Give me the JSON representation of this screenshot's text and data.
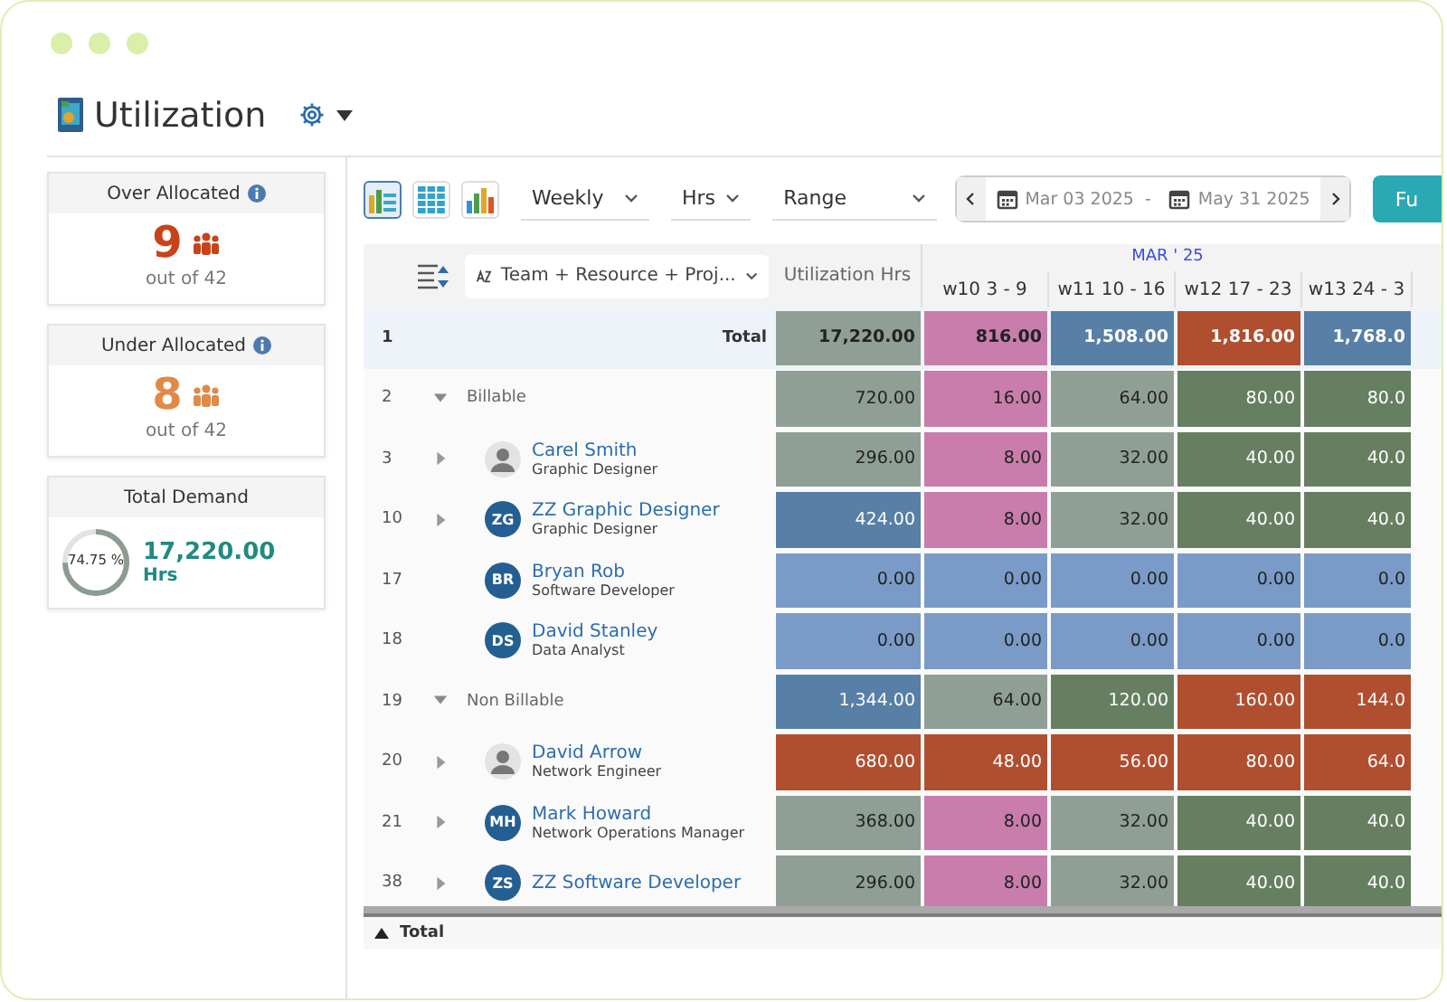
{
  "title": "Utilization",
  "cards": [
    {
      "kind": "count",
      "title": "Over Allocated",
      "value": "9",
      "color": "#c8421a",
      "subtitle": "out of 42"
    },
    {
      "kind": "count",
      "title": "Under Allocated",
      "value": "8",
      "color": "#e08a4a",
      "subtitle": "out of 42"
    },
    {
      "kind": "donut",
      "title": "Total Demand",
      "percent": "74.75 %",
      "level": 0.7475,
      "value": "17,220.00",
      "unit": "Hrs"
    }
  ],
  "toolbar": {
    "views": [
      {
        "selected": true
      },
      {
        "selected": false
      },
      {
        "selected": false
      }
    ],
    "dropdowns": [
      {
        "value": "Weekly"
      },
      {
        "value": "Hrs"
      },
      {
        "value": "Range"
      }
    ],
    "date_start": "Mar 03 2025",
    "date_separator": "-",
    "date_end": "May 31 2025",
    "button": "Fu"
  },
  "grid": {
    "group_by": "Team + Resource + Proj...",
    "util_header": "Utilization Hrs",
    "month": "MAR ' 25",
    "weeks": [
      "w10 3 - 9",
      "w11 10 - 16",
      "w12 17 - 23",
      "w13 24 - 3"
    ],
    "rows": [
      {
        "number": "1",
        "kind": "total",
        "label": "Total",
        "cells": [
          {
            "value": "17,220.00",
            "color": "#909f95"
          },
          {
            "value": "816.00",
            "color": "#c87dac"
          },
          {
            "value": "1,508.00",
            "color": "#587fa5"
          },
          {
            "value": "1,816.00",
            "color": "#b04f30"
          },
          {
            "value": "1,768.0",
            "color": "#587fa5"
          }
        ]
      },
      {
        "number": "2",
        "kind": "group",
        "label": "Billable",
        "expanded": true,
        "cells": [
          {
            "value": "720.00",
            "color": "#909f95"
          },
          {
            "value": "16.00",
            "color": "#c87dac"
          },
          {
            "value": "64.00",
            "color": "#909f95"
          },
          {
            "value": "80.00",
            "color": "#667f61"
          },
          {
            "value": "80.0",
            "color": "#667f61"
          }
        ]
      },
      {
        "number": "3",
        "kind": "person",
        "name": "Carel Smith",
        "role": "Graphic Designer",
        "avatar": {
          "kind": "photo"
        },
        "expanded": false,
        "cells": [
          {
            "value": "296.00",
            "color": "#909f95"
          },
          {
            "value": "8.00",
            "color": "#c87dac"
          },
          {
            "value": "32.00",
            "color": "#909f95"
          },
          {
            "value": "40.00",
            "color": "#667f61"
          },
          {
            "value": "40.0",
            "color": "#667f61"
          }
        ]
      },
      {
        "number": "10",
        "kind": "person",
        "name": "ZZ Graphic Designer",
        "role": "Graphic Designer",
        "avatar": {
          "kind": "initials",
          "text": "ZG"
        },
        "expanded": false,
        "cells": [
          {
            "value": "424.00",
            "color": "#587fa5"
          },
          {
            "value": "8.00",
            "color": "#c87dac"
          },
          {
            "value": "32.00",
            "color": "#909f95"
          },
          {
            "value": "40.00",
            "color": "#667f61"
          },
          {
            "value": "40.0",
            "color": "#667f61"
          }
        ]
      },
      {
        "number": "17",
        "kind": "person",
        "name": "Bryan Rob",
        "role": "Software Developer",
        "avatar": {
          "kind": "initials",
          "text": "BR"
        },
        "cells": [
          {
            "value": "0.00",
            "color": "#7a9bc8"
          },
          {
            "value": "0.00",
            "color": "#7a9bc8"
          },
          {
            "value": "0.00",
            "color": "#7a9bc8"
          },
          {
            "value": "0.00",
            "color": "#7a9bc8"
          },
          {
            "value": "0.0",
            "color": "#7a9bc8"
          }
        ]
      },
      {
        "number": "18",
        "kind": "person",
        "name": "David Stanley",
        "role": "Data Analyst",
        "avatar": {
          "kind": "initials",
          "text": "DS"
        },
        "cells": [
          {
            "value": "0.00",
            "color": "#7a9bc8"
          },
          {
            "value": "0.00",
            "color": "#7a9bc8"
          },
          {
            "value": "0.00",
            "color": "#7a9bc8"
          },
          {
            "value": "0.00",
            "color": "#7a9bc8"
          },
          {
            "value": "0.0",
            "color": "#7a9bc8"
          }
        ]
      },
      {
        "number": "19",
        "kind": "group",
        "label": "Non Billable",
        "expanded": true,
        "cells": [
          {
            "value": "1,344.00",
            "color": "#587fa5"
          },
          {
            "value": "64.00",
            "color": "#909f95"
          },
          {
            "value": "120.00",
            "color": "#667f61"
          },
          {
            "value": "160.00",
            "color": "#b04f30"
          },
          {
            "value": "144.0",
            "color": "#b04f30"
          }
        ]
      },
      {
        "number": "20",
        "kind": "person",
        "name": "David Arrow",
        "role": "Network Engineer",
        "avatar": {
          "kind": "photo"
        },
        "expanded": false,
        "cells": [
          {
            "value": "680.00",
            "color": "#b04f30"
          },
          {
            "value": "48.00",
            "color": "#b04f30"
          },
          {
            "value": "56.00",
            "color": "#b04f30"
          },
          {
            "value": "80.00",
            "color": "#b04f30"
          },
          {
            "value": "64.0",
            "color": "#b04f30"
          }
        ]
      },
      {
        "number": "21",
        "kind": "person",
        "name": "Mark Howard",
        "role": "Network Operations Manager",
        "avatar": {
          "kind": "initials",
          "text": "MH"
        },
        "expanded": false,
        "cells": [
          {
            "value": "368.00",
            "color": "#909f95"
          },
          {
            "value": "8.00",
            "color": "#c87dac"
          },
          {
            "value": "32.00",
            "color": "#909f95"
          },
          {
            "value": "40.00",
            "color": "#667f61"
          },
          {
            "value": "40.0",
            "color": "#667f61"
          }
        ]
      },
      {
        "number": "38",
        "kind": "person",
        "name": "ZZ Software Developer",
        "avatar": {
          "kind": "initials",
          "text": "ZS"
        },
        "expanded": false,
        "cells": [
          {
            "value": "296.00",
            "color": "#909f95"
          },
          {
            "value": "8.00",
            "color": "#c87dac"
          },
          {
            "value": "32.00",
            "color": "#909f95"
          },
          {
            "value": "40.00",
            "color": "#667f61"
          },
          {
            "value": "40.0",
            "color": "#667f61"
          }
        ]
      }
    ],
    "footer": "Total"
  }
}
